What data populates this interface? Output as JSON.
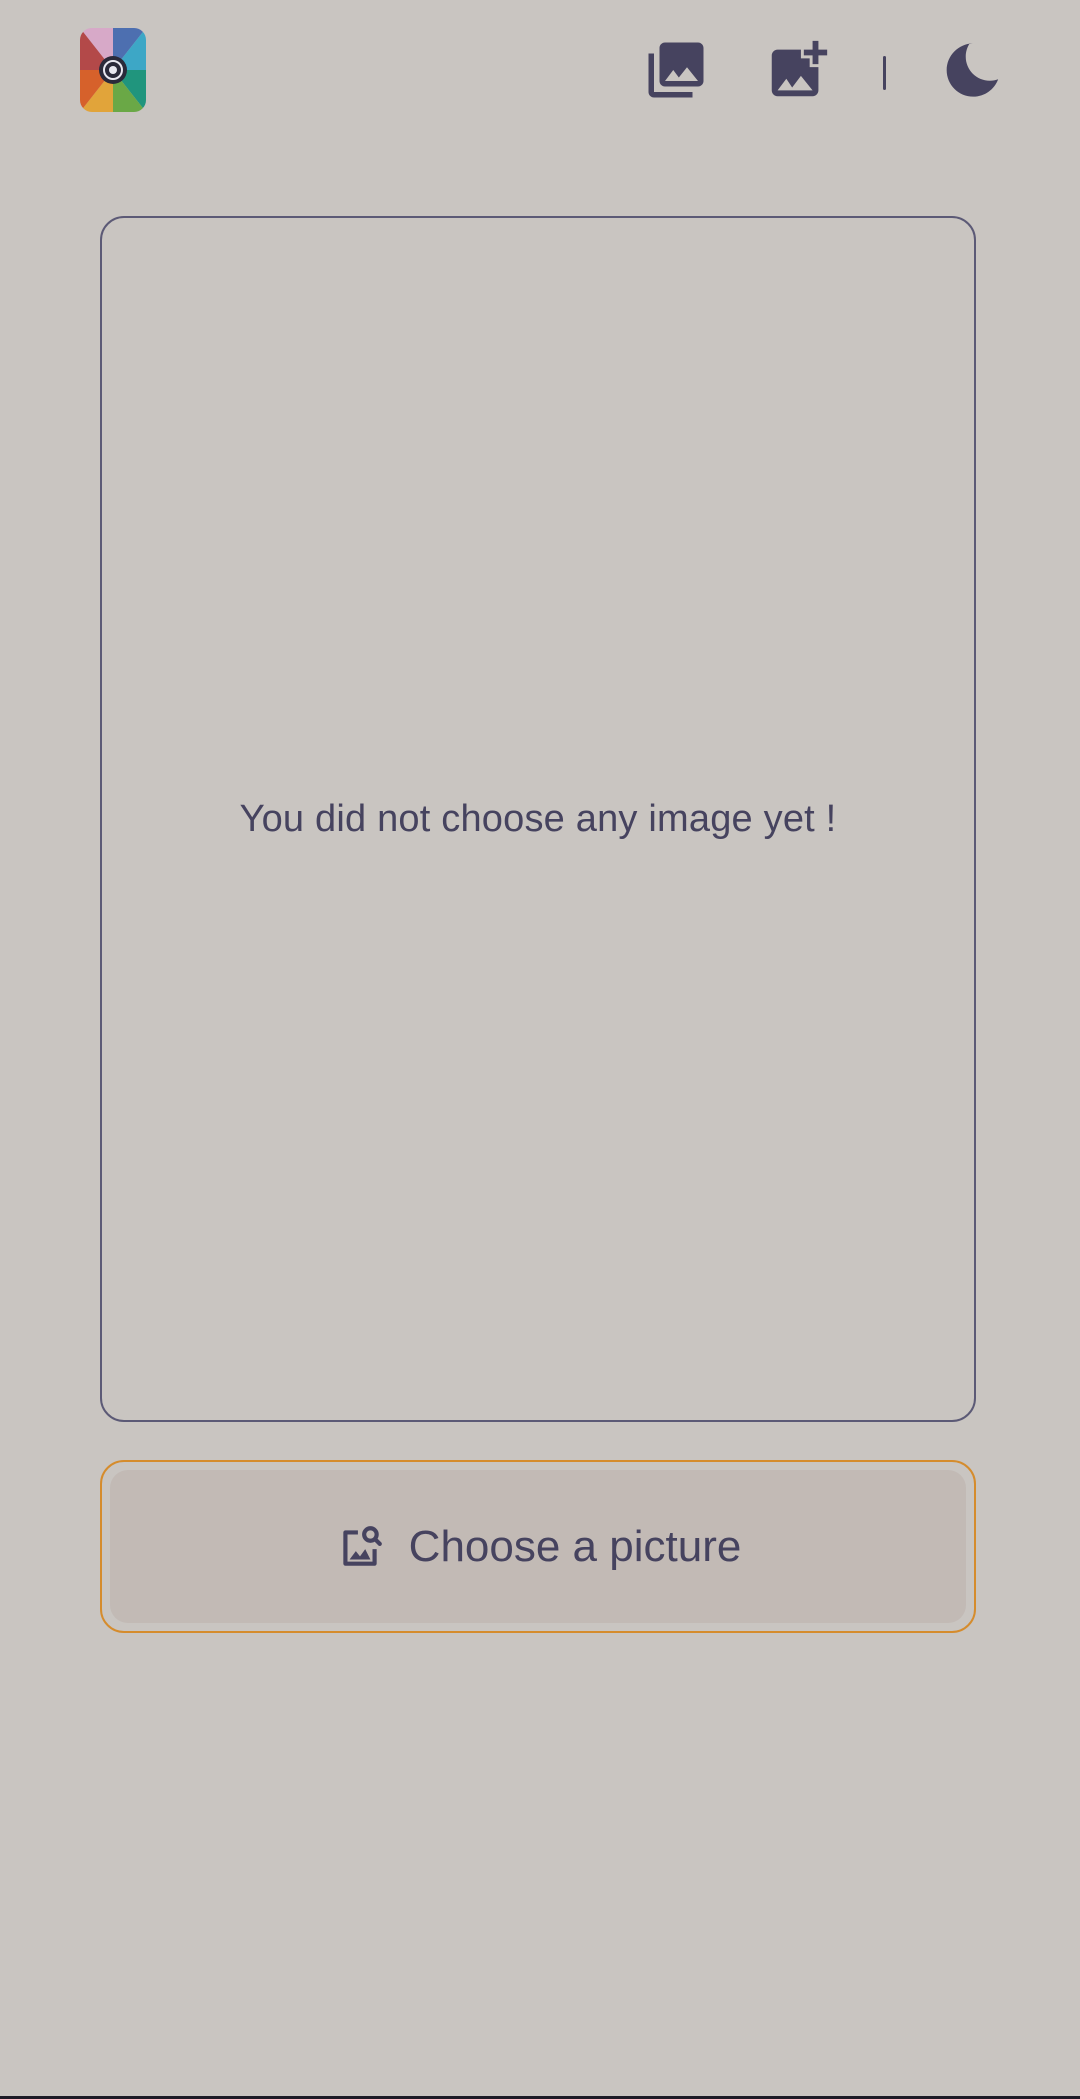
{
  "header": {
    "logo_icon": "app-logo-aperture",
    "gallery_icon": "photo-library-icon",
    "add_icon": "add-photo-icon",
    "theme_icon": "moon-icon"
  },
  "preview": {
    "empty_message": "You did not choose any image yet !"
  },
  "actions": {
    "choose_label": "Choose a picture",
    "choose_icon": "image-search-icon"
  },
  "colors": {
    "background": "#c9c5c1",
    "primary": "#46435f",
    "accent": "#d58c2d"
  }
}
